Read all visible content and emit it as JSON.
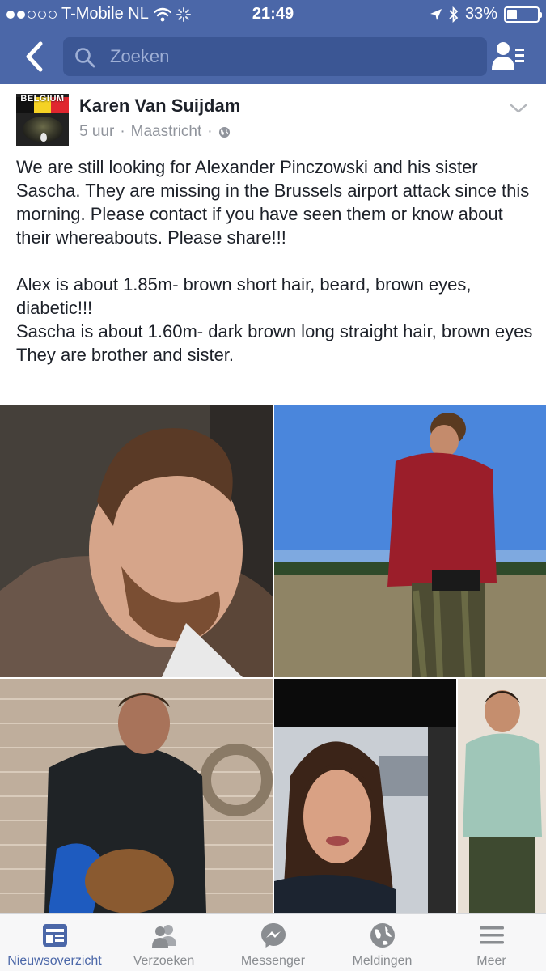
{
  "status_bar": {
    "carrier": "T-Mobile NL",
    "time": "21:49",
    "battery": "33%",
    "signal_bars": 2,
    "battery_level": 0.33
  },
  "nav": {
    "search_placeholder": "Zoeken"
  },
  "post": {
    "author": "Karen Van Suijdam",
    "avatar_label": "BELGIUM",
    "time": "5 uur",
    "separator": "·",
    "location": "Maastricht",
    "paragraphs": [
      "We are still looking for Alexander Pinczowski and his sister Sascha. They are missing in the Brussels airport attack since this morning. Please contact if you have seen them or know about their whereabouts. Please share!!!",
      "Alex is about 1.85m- brown short hair, beard, brown eyes, diabetic!!!",
      "Sascha is about 1.60m- dark brown long straight hair, brown eyes",
      "They are brother and sister."
    ]
  },
  "tabbar": {
    "tabs": [
      {
        "label": "Nieuwsoverzicht",
        "icon": "news-feed-icon",
        "active": true
      },
      {
        "label": "Verzoeken",
        "icon": "friend-requests-icon",
        "active": false
      },
      {
        "label": "Messenger",
        "icon": "messenger-icon",
        "active": false
      },
      {
        "label": "Meldingen",
        "icon": "globe-notifications-icon",
        "active": false
      },
      {
        "label": "Meer",
        "icon": "menu-icon",
        "active": false
      }
    ]
  },
  "colors": {
    "brand": "#4b67a8",
    "search_bg": "#3b5694",
    "meta_text": "#90949c",
    "tab_inactive": "#8a8d91"
  }
}
